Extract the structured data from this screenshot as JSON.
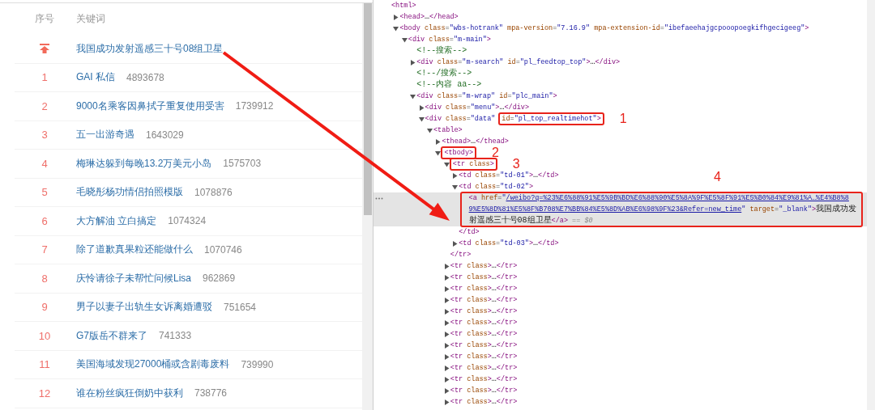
{
  "hot_list": {
    "columns": [
      "序号",
      "关键词"
    ],
    "rows": [
      {
        "kind": "pinned",
        "keyword": "我国成功发射遥感三十号08组卫星"
      },
      {
        "kind": "ranked",
        "rank": "1",
        "keyword": "GAI 私信",
        "count": "4893678"
      },
      {
        "kind": "ranked",
        "rank": "2",
        "keyword": "9000名乘客因鼻拭子重复使用受害",
        "count": "1739912"
      },
      {
        "kind": "ranked",
        "rank": "3",
        "keyword": "五一出游奇遇",
        "count": "1643029"
      },
      {
        "kind": "ranked",
        "rank": "4",
        "keyword": "梅琳达躲到每晚13.2万美元小岛",
        "count": "1575703"
      },
      {
        "kind": "ranked",
        "rank": "5",
        "keyword": "毛晓彤杨功情侣拍照模版",
        "count": "1078876"
      },
      {
        "kind": "ranked",
        "rank": "6",
        "keyword": "大方解油 立白搞定",
        "count": "1074324"
      },
      {
        "kind": "ranked",
        "rank": "7",
        "keyword": "除了道歉真果粒还能做什么",
        "count": "1070746"
      },
      {
        "kind": "ranked",
        "rank": "8",
        "keyword": "庆怜请徐子未帮忙问候Lisa",
        "count": "962869"
      },
      {
        "kind": "ranked",
        "rank": "9",
        "keyword": "男子以妻子出轨生女诉离婚遭驳",
        "count": "751654"
      },
      {
        "kind": "ranked",
        "rank": "10",
        "keyword": "G7版岳不群来了",
        "count": "741333"
      },
      {
        "kind": "ranked",
        "rank": "11",
        "keyword": "美国海域发现27000桶或含剧毒废料",
        "count": "739990"
      },
      {
        "kind": "ranked",
        "rank": "12",
        "keyword": "谁在粉丝疯狂倒奶中获利",
        "count": "738776"
      }
    ]
  },
  "devtools": {
    "dom": {
      "selected": false,
      "open": [
        {
          "kind": "tag",
          "text": "<html>"
        }
      ],
      "children": [
        {
          "selected": false,
          "expanded": false,
          "open": [
            {
              "kind": "tag",
              "text": "<head>"
            },
            {
              "kind": "text",
              "text": "…"
            },
            {
              "kind": "tag",
              "text": "</head>"
            }
          ]
        },
        {
          "selected": false,
          "expanded": true,
          "open": [
            {
              "kind": "tag",
              "text": "<body "
            },
            {
              "kind": "attr",
              "text": "class"
            },
            {
              "kind": "punct",
              "text": "="
            },
            {
              "kind": "value",
              "text": "\"wbs-hotrank\""
            },
            {
              "kind": "attr",
              "text": " mpa-version"
            },
            {
              "kind": "punct",
              "text": "="
            },
            {
              "kind": "value",
              "text": "\"7.16.9\""
            },
            {
              "kind": "attr",
              "text": " mpa-extension-id"
            },
            {
              "kind": "punct",
              "text": "="
            },
            {
              "kind": "value",
              "text": "\"ibefaeehajgcpooopoegkifhgecigeeg\""
            },
            {
              "kind": "tag",
              "text": ">"
            }
          ],
          "children": [
            {
              "selected": false,
              "expanded": true,
              "open": [
                {
                  "kind": "tag",
                  "text": "<div "
                },
                {
                  "kind": "attr",
                  "text": "class"
                },
                {
                  "kind": "punct",
                  "text": "="
                },
                {
                  "kind": "value",
                  "text": "\"m-main\""
                },
                {
                  "kind": "tag",
                  "text": ">"
                }
              ],
              "children": [
                {
                  "selected": false,
                  "open": [
                    {
                      "kind": "comment",
                      "text": "<!--搜索-->"
                    }
                  ]
                },
                {
                  "selected": false,
                  "expanded": false,
                  "open": [
                    {
                      "kind": "tag",
                      "text": "<div "
                    },
                    {
                      "kind": "attr",
                      "text": "class"
                    },
                    {
                      "kind": "punct",
                      "text": "="
                    },
                    {
                      "kind": "value",
                      "text": "\"m-search\""
                    },
                    {
                      "kind": "attr",
                      "text": " id"
                    },
                    {
                      "kind": "punct",
                      "text": "="
                    },
                    {
                      "kind": "value",
                      "text": "\"pl_feedtop_top\""
                    },
                    {
                      "kind": "tag",
                      "text": ">"
                    },
                    {
                      "kind": "text",
                      "text": "…"
                    },
                    {
                      "kind": "tag",
                      "text": "</div>"
                    }
                  ]
                },
                {
                  "selected": false,
                  "open": [
                    {
                      "kind": "comment",
                      "text": "<!--/搜索-->"
                    }
                  ]
                },
                {
                  "selected": false,
                  "open": [
                    {
                      "kind": "comment",
                      "text": "<!--内容 aa-->"
                    }
                  ]
                },
                {
                  "selected": false,
                  "expanded": true,
                  "open": [
                    {
                      "kind": "tag",
                      "text": "<div "
                    },
                    {
                      "kind": "attr",
                      "text": "class"
                    },
                    {
                      "kind": "punct",
                      "text": "="
                    },
                    {
                      "kind": "value",
                      "text": "\"m-wrap\""
                    },
                    {
                      "kind": "attr",
                      "text": " id"
                    },
                    {
                      "kind": "punct",
                      "text": "="
                    },
                    {
                      "kind": "value",
                      "text": "\"plc_main\""
                    },
                    {
                      "kind": "tag",
                      "text": ">"
                    }
                  ],
                  "children": [
                    {
                      "selected": false,
                      "expanded": false,
                      "open": [
                        {
                          "kind": "tag",
                          "text": "<div "
                        },
                        {
                          "kind": "attr",
                          "text": "class"
                        },
                        {
                          "kind": "punct",
                          "text": "="
                        },
                        {
                          "kind": "value",
                          "text": "\"menu\""
                        },
                        {
                          "kind": "tag",
                          "text": ">"
                        },
                        {
                          "kind": "text",
                          "text": "…"
                        },
                        {
                          "kind": "tag",
                          "text": "</div>"
                        }
                      ]
                    },
                    {
                      "selected": false,
                      "expanded": true,
                      "open": [
                        {
                          "kind": "tag",
                          "text": "<div "
                        },
                        {
                          "kind": "attr",
                          "text": "class"
                        },
                        {
                          "kind": "punct",
                          "text": "="
                        },
                        {
                          "kind": "value",
                          "text": "\"data\""
                        }
                      ],
                      "annotation": {
                        "label": "1",
                        "tokens": [
                          {
                            "kind": "attr",
                            "text": "id"
                          },
                          {
                            "kind": "punct",
                            "text": "="
                          },
                          {
                            "kind": "value",
                            "text": "\"pl_top_realtimehot\""
                          },
                          {
                            "kind": "tag",
                            "text": ">"
                          }
                        ]
                      },
                      "children": [
                        {
                          "selected": false,
                          "expanded": true,
                          "open": [
                            {
                              "kind": "tag",
                              "text": "<table>"
                            }
                          ],
                          "children": [
                            {
                              "selected": false,
                              "expanded": false,
                              "open": [
                                {
                                  "kind": "tag",
                                  "text": "<thead>"
                                },
                                {
                                  "kind": "text",
                                  "text": "…"
                                },
                                {
                                  "kind": "tag",
                                  "text": "</thead>"
                                }
                              ]
                            },
                            {
                              "selected": false,
                              "expanded": true,
                              "annotation": {
                                "label": "2",
                                "tokens": [
                                  {
                                    "kind": "tag",
                                    "text": "<tbody>"
                                  }
                                ]
                              },
                              "children": [
                                {
                                  "selected": false,
                                  "expanded": true,
                                  "annotation": {
                                    "label": "3",
                                    "tokens": [
                                      {
                                        "kind": "tag",
                                        "text": "<tr "
                                      },
                                      {
                                        "kind": "attr",
                                        "text": "class"
                                      },
                                      {
                                        "kind": "tag",
                                        "text": ">"
                                      }
                                    ]
                                  },
                                  "close": [
                                    {
                                      "kind": "tag",
                                      "text": "</tr>"
                                    }
                                  ],
                                  "children": [
                                    {
                                      "selected": false,
                                      "expanded": false,
                                      "open": [
                                        {
                                          "kind": "tag",
                                          "text": "<td "
                                        },
                                        {
                                          "kind": "attr",
                                          "text": "class"
                                        },
                                        {
                                          "kind": "punct",
                                          "text": "="
                                        },
                                        {
                                          "kind": "value",
                                          "text": "\"td-01\""
                                        },
                                        {
                                          "kind": "tag",
                                          "text": ">"
                                        },
                                        {
                                          "kind": "text",
                                          "text": "…"
                                        },
                                        {
                                          "kind": "tag",
                                          "text": "</td>"
                                        }
                                      ]
                                    },
                                    {
                                      "selected": false,
                                      "expanded": true,
                                      "open": [
                                        {
                                          "kind": "tag",
                                          "text": "<td "
                                        },
                                        {
                                          "kind": "attr",
                                          "text": "class"
                                        },
                                        {
                                          "kind": "punct",
                                          "text": "="
                                        },
                                        {
                                          "kind": "value",
                                          "text": "\"td-02\""
                                        },
                                        {
                                          "kind": "tag",
                                          "text": ">"
                                        }
                                      ],
                                      "close": [
                                        {
                                          "kind": "tag",
                                          "text": "</td>"
                                        }
                                      ],
                                      "children": [
                                        {
                                          "selected": true,
                                          "annotation": {
                                            "label": "4",
                                            "tokens": [
                                              {
                                                "kind": "tag",
                                                "text": "<a "
                                              },
                                              {
                                                "kind": "attr",
                                                "text": "href"
                                              },
                                              {
                                                "kind": "punct",
                                                "text": "="
                                              },
                                              {
                                                "kind": "value",
                                                "text": "\""
                                              },
                                              {
                                                "kind": "link",
                                                "text": "/weibo?q=%23%E6%88%91%E5%9B%BD%E6%88%90%E5%8A%9F%E5%8F%91%E5%B0%84%E9%81%A…%E4%B8%89%E5%8D%81%E5%8F%B708%E7%BB%84%E5%8D%AB%E6%98%9F%23&Refer=new_time"
                                              },
                                              {
                                                "kind": "value",
                                                "text": "\""
                                              },
                                              {
                                                "kind": "attr",
                                                "text": " target"
                                              },
                                              {
                                                "kind": "punct",
                                                "text": "="
                                              },
                                              {
                                                "kind": "value",
                                                "text": "\"_blank\""
                                              },
                                              {
                                                "kind": "tag",
                                                "text": ">"
                                              },
                                              {
                                                "kind": "text",
                                                "text": "我国成功发射遥感三十号08组卫星"
                                              },
                                              {
                                                "kind": "tag",
                                                "text": "</a>"
                                              },
                                              {
                                                "kind": "dim",
                                                "text": " == $0"
                                              }
                                            ]
                                          }
                                        }
                                      ]
                                    },
                                    {
                                      "selected": false,
                                      "expanded": false,
                                      "open": [
                                        {
                                          "kind": "tag",
                                          "text": "<td "
                                        },
                                        {
                                          "kind": "attr",
                                          "text": "class"
                                        },
                                        {
                                          "kind": "punct",
                                          "text": "="
                                        },
                                        {
                                          "kind": "value",
                                          "text": "\"td-03\""
                                        },
                                        {
                                          "kind": "tag",
                                          "text": ">"
                                        },
                                        {
                                          "kind": "text",
                                          "text": "…"
                                        },
                                        {
                                          "kind": "tag",
                                          "text": "</td>"
                                        }
                                      ]
                                    }
                                  ]
                                },
                                {
                                  "selected": false,
                                  "expanded": false,
                                  "open": [
                                    {
                                      "kind": "tag",
                                      "text": "<tr "
                                    },
                                    {
                                      "kind": "attr",
                                      "text": "class"
                                    },
                                    {
                                      "kind": "tag",
                                      "text": ">"
                                    },
                                    {
                                      "kind": "text",
                                      "text": "…"
                                    },
                                    {
                                      "kind": "tag",
                                      "text": "</tr>"
                                    }
                                  ]
                                },
                                {
                                  "selected": false,
                                  "expanded": false,
                                  "open": [
                                    {
                                      "kind": "tag",
                                      "text": "<tr "
                                    },
                                    {
                                      "kind": "attr",
                                      "text": "class"
                                    },
                                    {
                                      "kind": "tag",
                                      "text": ">"
                                    },
                                    {
                                      "kind": "text",
                                      "text": "…"
                                    },
                                    {
                                      "kind": "tag",
                                      "text": "</tr>"
                                    }
                                  ]
                                },
                                {
                                  "selected": false,
                                  "expanded": false,
                                  "open": [
                                    {
                                      "kind": "tag",
                                      "text": "<tr "
                                    },
                                    {
                                      "kind": "attr",
                                      "text": "class"
                                    },
                                    {
                                      "kind": "tag",
                                      "text": ">"
                                    },
                                    {
                                      "kind": "text",
                                      "text": "…"
                                    },
                                    {
                                      "kind": "tag",
                                      "text": "</tr>"
                                    }
                                  ]
                                },
                                {
                                  "selected": false,
                                  "expanded": false,
                                  "open": [
                                    {
                                      "kind": "tag",
                                      "text": "<tr "
                                    },
                                    {
                                      "kind": "attr",
                                      "text": "class"
                                    },
                                    {
                                      "kind": "tag",
                                      "text": ">"
                                    },
                                    {
                                      "kind": "text",
                                      "text": "…"
                                    },
                                    {
                                      "kind": "tag",
                                      "text": "</tr>"
                                    }
                                  ]
                                },
                                {
                                  "selected": false,
                                  "expanded": false,
                                  "open": [
                                    {
                                      "kind": "tag",
                                      "text": "<tr "
                                    },
                                    {
                                      "kind": "attr",
                                      "text": "class"
                                    },
                                    {
                                      "kind": "tag",
                                      "text": ">"
                                    },
                                    {
                                      "kind": "text",
                                      "text": "…"
                                    },
                                    {
                                      "kind": "tag",
                                      "text": "</tr>"
                                    }
                                  ]
                                },
                                {
                                  "selected": false,
                                  "expanded": false,
                                  "open": [
                                    {
                                      "kind": "tag",
                                      "text": "<tr "
                                    },
                                    {
                                      "kind": "attr",
                                      "text": "class"
                                    },
                                    {
                                      "kind": "tag",
                                      "text": ">"
                                    },
                                    {
                                      "kind": "text",
                                      "text": "…"
                                    },
                                    {
                                      "kind": "tag",
                                      "text": "</tr>"
                                    }
                                  ]
                                },
                                {
                                  "selected": false,
                                  "expanded": false,
                                  "open": [
                                    {
                                      "kind": "tag",
                                      "text": "<tr "
                                    },
                                    {
                                      "kind": "attr",
                                      "text": "class"
                                    },
                                    {
                                      "kind": "tag",
                                      "text": ">"
                                    },
                                    {
                                      "kind": "text",
                                      "text": "…"
                                    },
                                    {
                                      "kind": "tag",
                                      "text": "</tr>"
                                    }
                                  ]
                                },
                                {
                                  "selected": false,
                                  "expanded": false,
                                  "open": [
                                    {
                                      "kind": "tag",
                                      "text": "<tr "
                                    },
                                    {
                                      "kind": "attr",
                                      "text": "class"
                                    },
                                    {
                                      "kind": "tag",
                                      "text": ">"
                                    },
                                    {
                                      "kind": "text",
                                      "text": "…"
                                    },
                                    {
                                      "kind": "tag",
                                      "text": "</tr>"
                                    }
                                  ]
                                },
                                {
                                  "selected": false,
                                  "expanded": false,
                                  "open": [
                                    {
                                      "kind": "tag",
                                      "text": "<tr "
                                    },
                                    {
                                      "kind": "attr",
                                      "text": "class"
                                    },
                                    {
                                      "kind": "tag",
                                      "text": ">"
                                    },
                                    {
                                      "kind": "text",
                                      "text": "…"
                                    },
                                    {
                                      "kind": "tag",
                                      "text": "</tr>"
                                    }
                                  ]
                                },
                                {
                                  "selected": false,
                                  "expanded": false,
                                  "open": [
                                    {
                                      "kind": "tag",
                                      "text": "<tr "
                                    },
                                    {
                                      "kind": "attr",
                                      "text": "class"
                                    },
                                    {
                                      "kind": "tag",
                                      "text": ">"
                                    },
                                    {
                                      "kind": "text",
                                      "text": "…"
                                    },
                                    {
                                      "kind": "tag",
                                      "text": "</tr>"
                                    }
                                  ]
                                },
                                {
                                  "selected": false,
                                  "expanded": false,
                                  "open": [
                                    {
                                      "kind": "tag",
                                      "text": "<tr "
                                    },
                                    {
                                      "kind": "attr",
                                      "text": "class"
                                    },
                                    {
                                      "kind": "tag",
                                      "text": ">"
                                    },
                                    {
                                      "kind": "text",
                                      "text": "…"
                                    },
                                    {
                                      "kind": "tag",
                                      "text": "</tr>"
                                    }
                                  ]
                                },
                                {
                                  "selected": false,
                                  "expanded": false,
                                  "open": [
                                    {
                                      "kind": "tag",
                                      "text": "<tr "
                                    },
                                    {
                                      "kind": "attr",
                                      "text": "class"
                                    },
                                    {
                                      "kind": "tag",
                                      "text": ">"
                                    },
                                    {
                                      "kind": "text",
                                      "text": "…"
                                    },
                                    {
                                      "kind": "tag",
                                      "text": "</tr>"
                                    }
                                  ]
                                },
                                {
                                  "selected": false,
                                  "expanded": false,
                                  "open": [
                                    {
                                      "kind": "tag",
                                      "text": "<tr "
                                    },
                                    {
                                      "kind": "attr",
                                      "text": "class"
                                    },
                                    {
                                      "kind": "tag",
                                      "text": ">"
                                    },
                                    {
                                      "kind": "text",
                                      "text": "…"
                                    },
                                    {
                                      "kind": "tag",
                                      "text": "</tr>"
                                    }
                                  ]
                                }
                              ]
                            }
                          ]
                        }
                      ]
                    }
                  ]
                }
              ]
            }
          ]
        }
      ]
    }
  }
}
